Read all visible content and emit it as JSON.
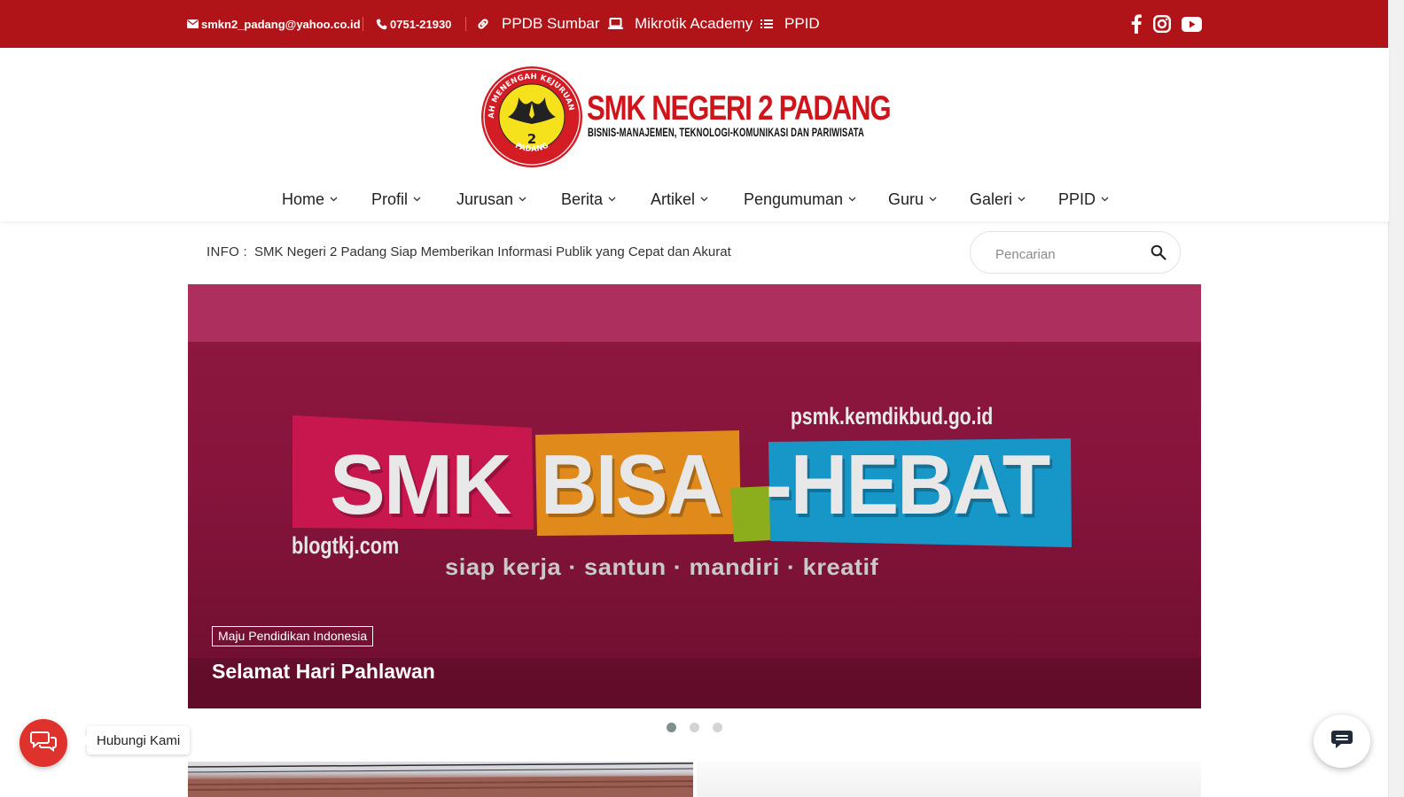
{
  "topbar": {
    "email": "smkn2_padang@yahoo.co.id",
    "phone": "0751-21930",
    "links": [
      {
        "label": "PPDB Sumbar",
        "icon": "link-icon"
      },
      {
        "label": "Mikrotik Academy",
        "icon": "laptop-icon"
      },
      {
        "label": "PPID",
        "icon": "list-icon"
      }
    ],
    "social": [
      "facebook-icon",
      "instagram-icon",
      "youtube-icon"
    ],
    "background_color": "#b01418"
  },
  "header": {
    "logo": {
      "title": "SMK NEGERI 2 PADANG",
      "subtitle": "BISNIS-MANAJEMEN, TEKNOLOGI-KOMUNIKASI DAN PARIWISATA",
      "emblem_ring_text": "SEKOLAH MENENGAH KEJURUAN NEGERI",
      "emblem_bottom_text": "PADANG",
      "emblem_number": "2"
    },
    "nav": [
      {
        "label": "Home"
      },
      {
        "label": "Profil"
      },
      {
        "label": "Jurusan"
      },
      {
        "label": "Berita"
      },
      {
        "label": "Artikel"
      },
      {
        "label": "Pengumuman"
      },
      {
        "label": "Guru"
      },
      {
        "label": "Galeri"
      },
      {
        "label": "PPID"
      }
    ]
  },
  "info": {
    "label": "INFO :",
    "text": "SMK Negeri 2 Padang Siap Memberikan Informasi Publik yang Cepat dan Akurat"
  },
  "search": {
    "placeholder": "Pencarian",
    "value": ""
  },
  "slider": {
    "banner": {
      "url": "psmk.kemdikbud.go.id",
      "word1": "SMK",
      "word2": "BISA",
      "word3": "-HEBAT",
      "source": "blogtkj.com",
      "tagline": "siap kerja · santun · mandiri · kreatif"
    },
    "category": "Maju Pendidikan Indonesia",
    "title": "Selamat Hari Pahlawan",
    "slide_count": 3,
    "active_slide": 1,
    "colors": {
      "magenta": "#c8174f",
      "orange": "#e08a1c",
      "green": "#8cae1c",
      "blue": "#1797c8"
    }
  },
  "chat": {
    "label": "Hubungi Kami",
    "color": "#e0322c"
  }
}
